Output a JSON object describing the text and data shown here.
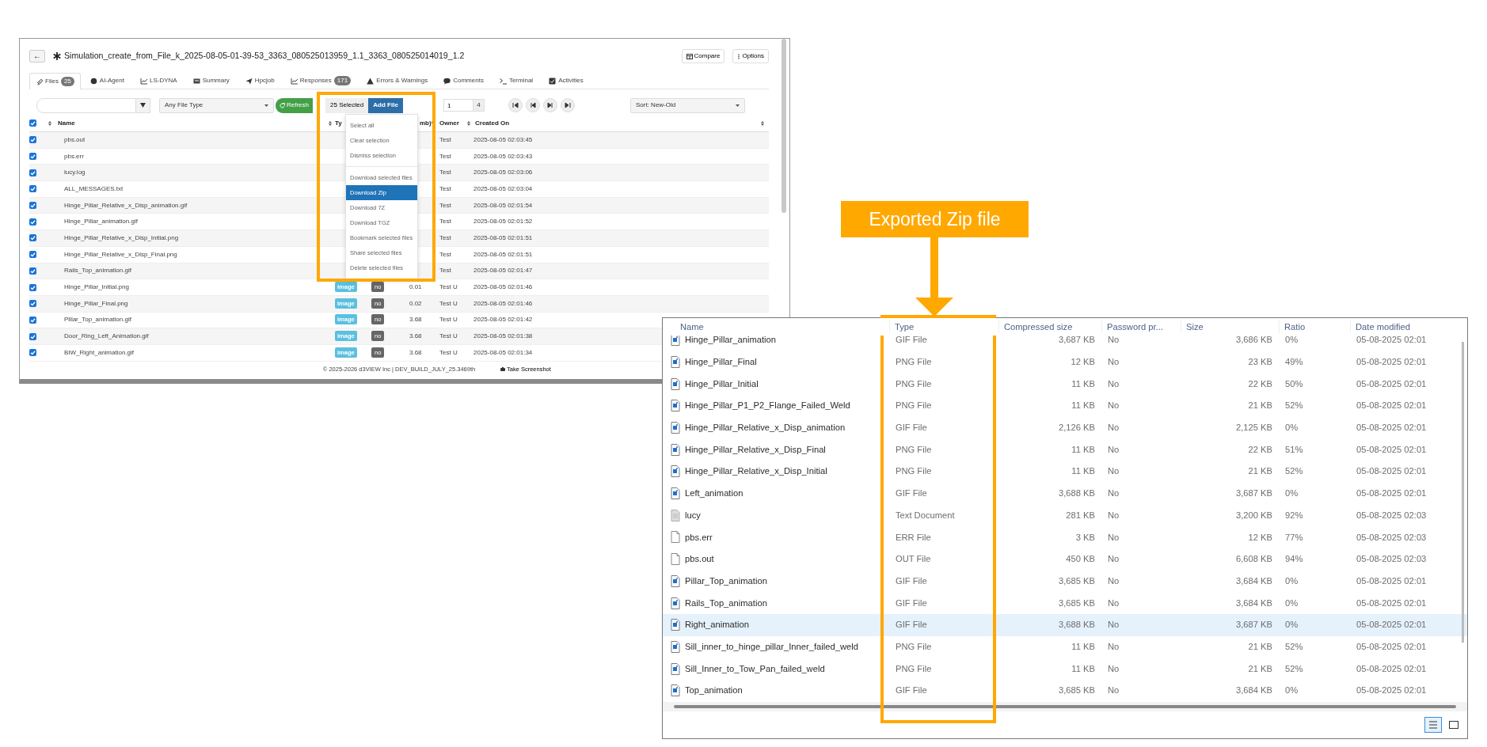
{
  "app_window": {
    "back": "←",
    "title": "Simulation_create_from_File_k_2025-08-05-01-39-53_3363_080525013959_1.1_3363_080525014019_1.2",
    "header_buttons": [
      "Compare",
      "Options"
    ],
    "tabs": [
      {
        "label": "Files",
        "count": "25",
        "selected": true
      },
      {
        "label": "AI-Agent",
        "selected": false
      },
      {
        "label": "LS-DYNA",
        "selected": false
      },
      {
        "label": "Summary",
        "selected": false
      },
      {
        "label": "Hpcjob",
        "selected": false
      },
      {
        "label": "Responses",
        "count": "171",
        "selected": false
      },
      {
        "label": "Errors & Warnings",
        "selected": false
      },
      {
        "label": "Comments",
        "selected": false
      },
      {
        "label": "Terminal",
        "selected": false
      },
      {
        "label": "Activities",
        "selected": false
      }
    ],
    "toolbar": {
      "file_type": "Any File Type",
      "refresh": "Refresh",
      "selection": "25 Selected",
      "add_file": "Add File",
      "page": "1",
      "page_count": "4",
      "sort": "Sort: New-Old"
    },
    "header_checked": true,
    "columns": {
      "name": "Name",
      "type": "Ty",
      "size": "mb)*",
      "owner": "Owner",
      "created": "Created On"
    },
    "rows": [
      {
        "checked": true,
        "name": "pbs.out",
        "owner": "Test",
        "created": "2025-08-05 02:03:45"
      },
      {
        "checked": true,
        "name": "pbs.err",
        "owner": "Test",
        "created": "2025-08-05 02:03:43"
      },
      {
        "checked": true,
        "name": "lucy.log",
        "owner": "Test",
        "created": "2025-08-05 02:03:06"
      },
      {
        "checked": true,
        "name": "ALL_MESSAGES.txt",
        "owner": "Test",
        "created": "2025-08-05 02:03:04"
      },
      {
        "checked": true,
        "name": "Hinge_Pillar_Relative_x_Disp_animation.gif",
        "owner": "Test",
        "created": "2025-08-05 02:01:54"
      },
      {
        "checked": true,
        "name": "Hinge_Pillar_animation.gif",
        "owner": "Test",
        "created": "2025-08-05 02:01:52"
      },
      {
        "checked": true,
        "name": "Hinge_Pillar_Relative_x_Disp_Initial.png",
        "owner": "Test",
        "created": "2025-08-05 02:01:51"
      },
      {
        "checked": true,
        "name": "Hinge_Pillar_Relative_x_Disp_Final.png",
        "owner": "Test",
        "created": "2025-08-05 02:01:51"
      },
      {
        "checked": true,
        "name": "Rails_Top_animation.gif",
        "owner": "Test",
        "created": "2025-08-05 02:01:47"
      },
      {
        "checked": true,
        "name": "Hinge_Pillar_Initial.png",
        "type": "image",
        "access": "no",
        "size": "0.01",
        "owner": "Test U",
        "created": "2025-08-05 02:01:46"
      },
      {
        "checked": true,
        "name": "Hinge_Pillar_Final.png",
        "type": "image",
        "access": "no",
        "size": "0.02",
        "owner": "Test U",
        "created": "2025-08-05 02:01:46"
      },
      {
        "checked": true,
        "name": "Pillar_Top_animation.gif",
        "type": "image",
        "access": "no",
        "size": "3.68",
        "owner": "Test U",
        "created": "2025-08-05 02:01:42"
      },
      {
        "checked": true,
        "name": "Door_Ring_Left_Animation.gif",
        "type": "image",
        "access": "no",
        "size": "3.68",
        "owner": "Test U",
        "created": "2025-08-05 02:01:38"
      },
      {
        "checked": true,
        "name": "BIW_Right_animation.gif",
        "type": "image",
        "access": "no",
        "size": "3.68",
        "owner": "Test U",
        "created": "2025-08-05 02:01:34"
      }
    ],
    "menu": [
      {
        "label": "Select all",
        "selected": false,
        "separator_before": false
      },
      {
        "label": "Clear selection",
        "selected": false,
        "separator_before": false
      },
      {
        "label": "Dismiss selection",
        "selected": false,
        "separator_before": false
      },
      {
        "label": "Download selected files",
        "selected": false,
        "separator_before": true
      },
      {
        "label": "Download Zip",
        "selected": true,
        "separator_before": false
      },
      {
        "label": "Download 7Z",
        "selected": false,
        "separator_before": false
      },
      {
        "label": "Download TGZ",
        "selected": false,
        "separator_before": false
      },
      {
        "label": "Bookmark selected files",
        "selected": false,
        "separator_before": false
      },
      {
        "label": "Share selected files",
        "selected": false,
        "separator_before": false
      },
      {
        "label": "Delete selected files",
        "selected": false,
        "separator_before": false
      }
    ],
    "footer": "© 2025-2026 d3VIEW Inc | DEV_BUILD_JULY_25.3469th",
    "screenshot_button": "Take Screenshot"
  },
  "callout": {
    "label": "Exported Zip file"
  },
  "zip_window": {
    "columns": [
      "Name",
      "Type",
      "Compressed size",
      "Password pr...",
      "Size",
      "Ratio",
      "Date modified"
    ],
    "rows": [
      {
        "kind": "image",
        "name": "Hinge_Pillar_animation",
        "type": "GIF File",
        "compressed": "3,687 KB",
        "password": "No",
        "size": "3,686 KB",
        "ratio": "0%",
        "date": "05-08-2025 02:01",
        "selected": false
      },
      {
        "kind": "image",
        "name": "Hinge_Pillar_Final",
        "type": "PNG File",
        "compressed": "12 KB",
        "password": "No",
        "size": "23 KB",
        "ratio": "49%",
        "date": "05-08-2025 02:01",
        "selected": false
      },
      {
        "kind": "image",
        "name": "Hinge_Pillar_Initial",
        "type": "PNG File",
        "compressed": "11 KB",
        "password": "No",
        "size": "22 KB",
        "ratio": "50%",
        "date": "05-08-2025 02:01",
        "selected": false
      },
      {
        "kind": "image",
        "name": "Hinge_Pillar_P1_P2_Flange_Failed_Weld",
        "type": "PNG File",
        "compressed": "11 KB",
        "password": "No",
        "size": "21 KB",
        "ratio": "52%",
        "date": "05-08-2025 02:01",
        "selected": false
      },
      {
        "kind": "image",
        "name": "Hinge_Pillar_Relative_x_Disp_animation",
        "type": "GIF File",
        "compressed": "2,126 KB",
        "password": "No",
        "size": "2,125 KB",
        "ratio": "0%",
        "date": "05-08-2025 02:01",
        "selected": false
      },
      {
        "kind": "image",
        "name": "Hinge_Pillar_Relative_x_Disp_Final",
        "type": "PNG File",
        "compressed": "11 KB",
        "password": "No",
        "size": "22 KB",
        "ratio": "51%",
        "date": "05-08-2025 02:01",
        "selected": false
      },
      {
        "kind": "image",
        "name": "Hinge_Pillar_Relative_x_Disp_Initial",
        "type": "PNG File",
        "compressed": "11 KB",
        "password": "No",
        "size": "21 KB",
        "ratio": "52%",
        "date": "05-08-2025 02:01",
        "selected": false
      },
      {
        "kind": "image",
        "name": "Left_animation",
        "type": "GIF File",
        "compressed": "3,688 KB",
        "password": "No",
        "size": "3,687 KB",
        "ratio": "0%",
        "date": "05-08-2025 02:01",
        "selected": false
      },
      {
        "kind": "text",
        "name": "lucy",
        "type": "Text Document",
        "compressed": "281 KB",
        "password": "No",
        "size": "3,200 KB",
        "ratio": "92%",
        "date": "05-08-2025 02:03",
        "selected": false
      },
      {
        "kind": "plain",
        "name": "pbs.err",
        "type": "ERR File",
        "compressed": "3 KB",
        "password": "No",
        "size": "12 KB",
        "ratio": "77%",
        "date": "05-08-2025 02:03",
        "selected": false
      },
      {
        "kind": "plain",
        "name": "pbs.out",
        "type": "OUT File",
        "compressed": "450 KB",
        "password": "No",
        "size": "6,608 KB",
        "ratio": "94%",
        "date": "05-08-2025 02:03",
        "selected": false
      },
      {
        "kind": "image",
        "name": "Pillar_Top_animation",
        "type": "GIF File",
        "compressed": "3,685 KB",
        "password": "No",
        "size": "3,684 KB",
        "ratio": "0%",
        "date": "05-08-2025 02:01",
        "selected": false
      },
      {
        "kind": "image",
        "name": "Rails_Top_animation",
        "type": "GIF File",
        "compressed": "3,685 KB",
        "password": "No",
        "size": "3,684 KB",
        "ratio": "0%",
        "date": "05-08-2025 02:01",
        "selected": false
      },
      {
        "kind": "image",
        "name": "Right_animation",
        "type": "GIF File",
        "compressed": "3,688 KB",
        "password": "No",
        "size": "3,687 KB",
        "ratio": "0%",
        "date": "05-08-2025 02:01",
        "selected": true
      },
      {
        "kind": "image",
        "name": "Sill_inner_to_hinge_pillar_Inner_failed_weld",
        "type": "PNG File",
        "compressed": "11 KB",
        "password": "No",
        "size": "21 KB",
        "ratio": "52%",
        "date": "05-08-2025 02:01",
        "selected": false
      },
      {
        "kind": "image",
        "name": "Sill_Inner_to_Tow_Pan_failed_weld",
        "type": "PNG File",
        "compressed": "11 KB",
        "password": "No",
        "size": "21 KB",
        "ratio": "52%",
        "date": "05-08-2025 02:01",
        "selected": false
      },
      {
        "kind": "image",
        "name": "Top_animation",
        "type": "GIF File",
        "compressed": "3,685 KB",
        "password": "No",
        "size": "3,684 KB",
        "ratio": "0%",
        "date": "05-08-2025 02:01",
        "selected": false
      }
    ],
    "views": [
      {
        "kind": "details",
        "selected": true
      },
      {
        "kind": "tiles",
        "selected": false
      }
    ]
  }
}
